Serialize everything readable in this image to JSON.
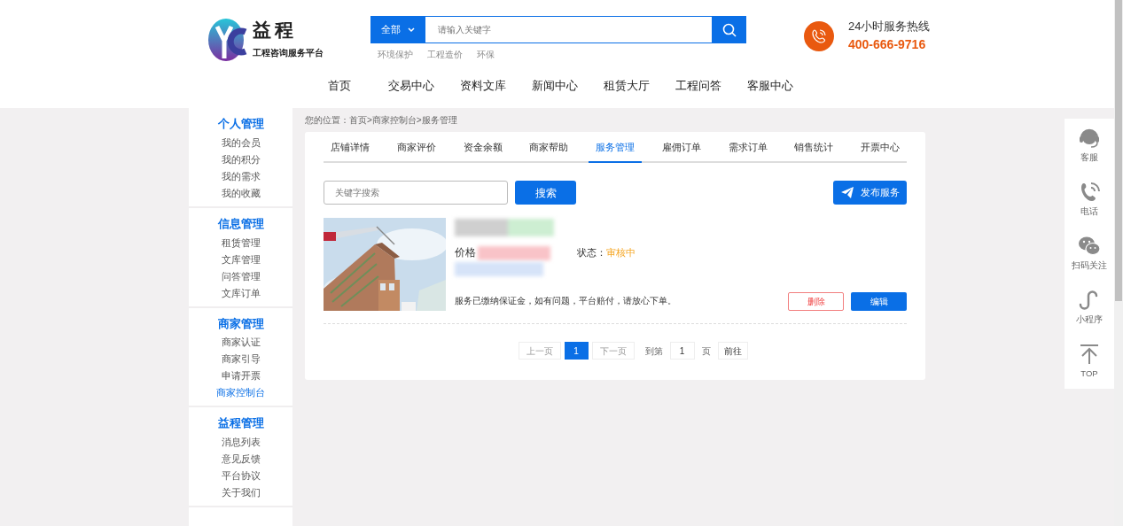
{
  "logo": {
    "name": "益程",
    "tagline": "工程咨询服务平台"
  },
  "search": {
    "category": "全部",
    "placeholder": "请输入关键字",
    "hot_keywords": [
      "环境保护",
      "工程造价",
      "环保"
    ]
  },
  "hotline": {
    "label": "24小时服务热线",
    "number": "400-666-9716"
  },
  "nav": [
    "首页",
    "交易中心",
    "资料文库",
    "新闻中心",
    "租赁大厅",
    "工程问答",
    "客服中心"
  ],
  "sidebar": [
    {
      "title": "个人管理",
      "items": [
        {
          "label": "我的会员",
          "selected": false
        },
        {
          "label": "我的积分",
          "selected": false
        },
        {
          "label": "我的需求",
          "selected": false
        },
        {
          "label": "我的收藏",
          "selected": false
        }
      ]
    },
    {
      "title": "信息管理",
      "items": [
        {
          "label": "租赁管理",
          "selected": false
        },
        {
          "label": "文库管理",
          "selected": false
        },
        {
          "label": "问答管理",
          "selected": false
        },
        {
          "label": "文库订单",
          "selected": false
        }
      ]
    },
    {
      "title": "商家管理",
      "items": [
        {
          "label": "商家认证",
          "selected": false
        },
        {
          "label": "商家引导",
          "selected": false
        },
        {
          "label": "申请开票",
          "selected": false
        },
        {
          "label": "商家控制台",
          "selected": true
        }
      ]
    },
    {
      "title": "益程管理",
      "items": [
        {
          "label": "消息列表",
          "selected": false
        },
        {
          "label": "意见反馈",
          "selected": false
        },
        {
          "label": "平台协议",
          "selected": false
        },
        {
          "label": "关于我们",
          "selected": false
        }
      ]
    }
  ],
  "breadcrumb": "您的位置：首页>商家控制台>服务管理",
  "tabs": [
    {
      "label": "店铺详情",
      "selected": false
    },
    {
      "label": "商家评价",
      "selected": false
    },
    {
      "label": "资金余额",
      "selected": false
    },
    {
      "label": "商家帮助",
      "selected": false
    },
    {
      "label": "服务管理",
      "selected": true
    },
    {
      "label": "雇佣订单",
      "selected": false
    },
    {
      "label": "需求订单",
      "selected": false
    },
    {
      "label": "销售统计",
      "selected": false
    },
    {
      "label": "开票中心",
      "selected": false
    }
  ],
  "filter": {
    "placeholder": "关键字搜索",
    "search_button": "搜索",
    "publish_button": "发布服务"
  },
  "services": [
    {
      "kind": "picture",
      "price_label": "价格",
      "status_label": "状态：",
      "status": "审核中",
      "note": "服务已缴纳保证金，如有问题，平台赔付，请放心下单。",
      "delete_button": "删除",
      "edit_button": "编辑"
    }
  ],
  "pagination": {
    "prev": "上一页",
    "prev_disabled": true,
    "pages": [
      {
        "label": "1",
        "selected": true
      }
    ],
    "next": "下一页",
    "next_disabled": true,
    "goto_label": "到第",
    "goto_value": "1",
    "unit": "页",
    "go_button": "前往"
  },
  "side_tools": [
    {
      "kind": "headset",
      "label": "客服"
    },
    {
      "kind": "phone",
      "label": "电话"
    },
    {
      "kind": "wechat",
      "label": "扫码关注"
    },
    {
      "kind": "miniprogram",
      "label": "小程序"
    },
    {
      "kind": "top",
      "label": "TOP"
    }
  ]
}
